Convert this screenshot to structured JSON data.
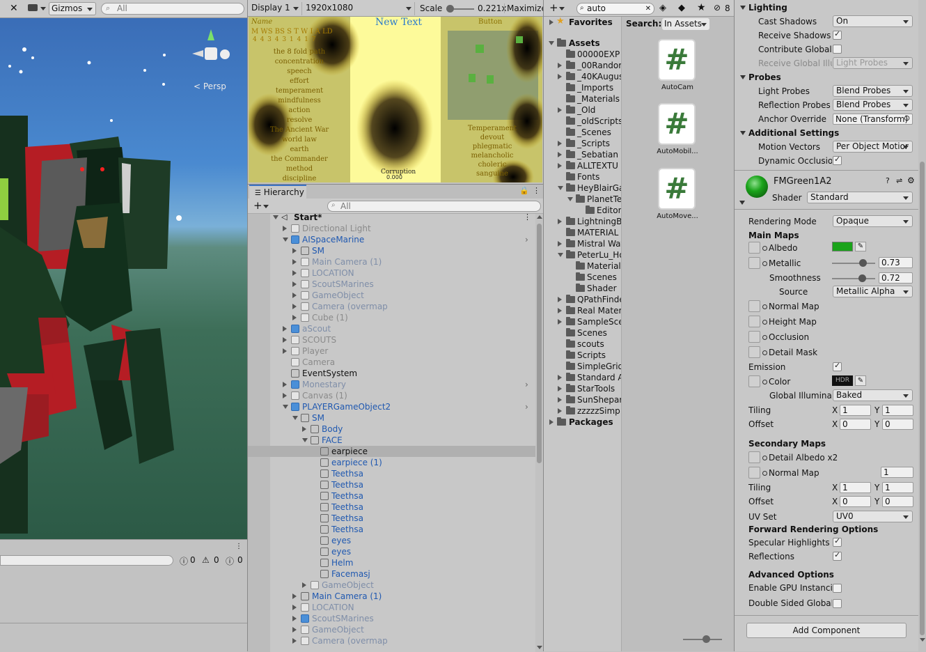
{
  "scene": {
    "toolbar": {
      "gizmos": "Gizmos",
      "search_placeholder": "All",
      "persp": "Persp"
    },
    "console": {
      "errors": "0",
      "warnings": "0",
      "messages": "0"
    }
  },
  "game": {
    "display": "Display 1",
    "resolution": "1920x1080",
    "scale_label": "Scale",
    "scale_value": "0.221x",
    "maximize": "Maximize",
    "overlay": {
      "name_header": "Name",
      "new_text": "New Text",
      "button_text": "Button",
      "stats_header": "M WS BS S T W I A LD",
      "stats_values": "4 4 3 4 3 1 4 1 7",
      "paths": [
        "the 8 fold path",
        "concentration",
        "speech",
        "effort",
        "temperament",
        "mindfulness",
        "action",
        "resolve",
        "The Ancient War",
        "world law",
        "earth",
        "the Commander",
        "method",
        "discipline"
      ],
      "right_list": [
        "Temperament",
        "devout",
        "phlegmatic",
        "melancholic",
        "choleric",
        "sanguine"
      ],
      "corruption": "Corruption",
      "corruption_value": "0.000"
    }
  },
  "hierarchy": {
    "title": "Hierarchy",
    "search_placeholder": "All",
    "scene_name": "Start*",
    "items": [
      {
        "label": "Directional Light",
        "indent": 1,
        "arrow": "r",
        "style": "dim",
        "icon": "gray"
      },
      {
        "label": "AISpaceMarine",
        "indent": 1,
        "arrow": "d",
        "style": "blue",
        "icon": "blue",
        "more": true
      },
      {
        "label": "SM",
        "indent": 2,
        "arrow": "r",
        "style": "blue",
        "icon": "plain"
      },
      {
        "label": "Main Camera (1)",
        "indent": 2,
        "arrow": "r",
        "style": "gray",
        "icon": "gray"
      },
      {
        "label": "LOCATION",
        "indent": 2,
        "arrow": "r",
        "style": "gray",
        "icon": "gray"
      },
      {
        "label": "ScoutSMarines",
        "indent": 2,
        "arrow": "r",
        "style": "gray",
        "icon": "gray"
      },
      {
        "label": "GameObject",
        "indent": 2,
        "arrow": "r",
        "style": "gray",
        "icon": "gray"
      },
      {
        "label": "Camera (overmap",
        "indent": 2,
        "arrow": "r",
        "style": "gray",
        "icon": "gray"
      },
      {
        "label": "Cube (1)",
        "indent": 2,
        "arrow": "r",
        "style": "dim",
        "icon": "gray"
      },
      {
        "label": "aScout",
        "indent": 1,
        "arrow": "r",
        "style": "gray",
        "icon": "blue"
      },
      {
        "label": "SCOUTS",
        "indent": 1,
        "arrow": "r",
        "style": "dim",
        "icon": "gray"
      },
      {
        "label": "Player",
        "indent": 1,
        "arrow": "r",
        "style": "dim",
        "icon": "gray"
      },
      {
        "label": "Camera",
        "indent": 1,
        "arrow": "",
        "style": "dim",
        "icon": "gray"
      },
      {
        "label": "EventSystem",
        "indent": 1,
        "arrow": "",
        "style": "normal",
        "icon": "plain"
      },
      {
        "label": "Monestary",
        "indent": 1,
        "arrow": "r",
        "style": "gray",
        "icon": "blue",
        "more": true
      },
      {
        "label": "Canvas (1)",
        "indent": 1,
        "arrow": "r",
        "style": "dim",
        "icon": "gray"
      },
      {
        "label": "PLAYERGameObject2",
        "indent": 1,
        "arrow": "d",
        "style": "blue",
        "icon": "blue",
        "more": true
      },
      {
        "label": "SM",
        "indent": 2,
        "arrow": "d",
        "style": "blue",
        "icon": "plain"
      },
      {
        "label": "Body",
        "indent": 3,
        "arrow": "r",
        "style": "blue",
        "icon": "plain"
      },
      {
        "label": "FACE",
        "indent": 3,
        "arrow": "d",
        "style": "blue",
        "icon": "plain"
      },
      {
        "label": "earpiece",
        "indent": 4,
        "arrow": "",
        "style": "normal",
        "icon": "plain",
        "selected": true
      },
      {
        "label": "earpiece (1)",
        "indent": 4,
        "arrow": "",
        "style": "blue",
        "icon": "plain"
      },
      {
        "label": "Teethsa",
        "indent": 4,
        "arrow": "",
        "style": "blue",
        "icon": "plain"
      },
      {
        "label": "Teethsa",
        "indent": 4,
        "arrow": "",
        "style": "blue",
        "icon": "plain"
      },
      {
        "label": "Teethsa",
        "indent": 4,
        "arrow": "",
        "style": "blue",
        "icon": "plain"
      },
      {
        "label": "Teethsa",
        "indent": 4,
        "arrow": "",
        "style": "blue",
        "icon": "plain"
      },
      {
        "label": "Teethsa",
        "indent": 4,
        "arrow": "",
        "style": "blue",
        "icon": "plain"
      },
      {
        "label": "Teethsa",
        "indent": 4,
        "arrow": "",
        "style": "blue",
        "icon": "plain"
      },
      {
        "label": "eyes",
        "indent": 4,
        "arrow": "",
        "style": "blue",
        "icon": "plain"
      },
      {
        "label": "eyes",
        "indent": 4,
        "arrow": "",
        "style": "blue",
        "icon": "plain"
      },
      {
        "label": "Helm",
        "indent": 4,
        "arrow": "",
        "style": "blue",
        "icon": "plain"
      },
      {
        "label": "Facemasj",
        "indent": 4,
        "arrow": "",
        "style": "blue",
        "icon": "plain"
      },
      {
        "label": "GameObject",
        "indent": 3,
        "arrow": "r",
        "style": "gray",
        "icon": "gray"
      },
      {
        "label": "Main Camera (1)",
        "indent": 2,
        "arrow": "r",
        "style": "blue",
        "icon": "plain"
      },
      {
        "label": "LOCATION",
        "indent": 2,
        "arrow": "r",
        "style": "gray",
        "icon": "gray"
      },
      {
        "label": "ScoutSMarines",
        "indent": 2,
        "arrow": "r",
        "style": "gray",
        "icon": "blue"
      },
      {
        "label": "GameObject",
        "indent": 2,
        "arrow": "r",
        "style": "gray",
        "icon": "gray"
      },
      {
        "label": "Camera (overmap",
        "indent": 2,
        "arrow": "r",
        "style": "gray",
        "icon": "gray"
      }
    ]
  },
  "project": {
    "search_value": "auto",
    "hidden_count": "8",
    "favorites": "Favorites",
    "assets": "Assets",
    "packages": "Packages",
    "search_label": "Search:",
    "search_scope": "In Assets",
    "tree": [
      {
        "label": "00000EXP",
        "indent": 1,
        "arrow": ""
      },
      {
        "label": "_00Randor",
        "indent": 1,
        "arrow": "r"
      },
      {
        "label": "_40KAugus",
        "indent": 1,
        "arrow": "r"
      },
      {
        "label": "_Imports",
        "indent": 1,
        "arrow": ""
      },
      {
        "label": "_Materials",
        "indent": 1,
        "arrow": ""
      },
      {
        "label": "_Old",
        "indent": 1,
        "arrow": "r"
      },
      {
        "label": "_oldScripts",
        "indent": 1,
        "arrow": ""
      },
      {
        "label": "_Scenes",
        "indent": 1,
        "arrow": ""
      },
      {
        "label": "_Scripts",
        "indent": 1,
        "arrow": "r"
      },
      {
        "label": "_Sebatian",
        "indent": 1,
        "arrow": "r"
      },
      {
        "label": "ALLTEXTU",
        "indent": 1,
        "arrow": "r"
      },
      {
        "label": "Fonts",
        "indent": 1,
        "arrow": ""
      },
      {
        "label": "HeyBlairGa",
        "indent": 1,
        "arrow": "d"
      },
      {
        "label": "PlanetTe",
        "indent": 2,
        "arrow": "d"
      },
      {
        "label": "Editor",
        "indent": 3,
        "arrow": ""
      },
      {
        "label": "LightningB",
        "indent": 1,
        "arrow": "r"
      },
      {
        "label": "MATERIAL",
        "indent": 1,
        "arrow": ""
      },
      {
        "label": "Mistral Wat",
        "indent": 1,
        "arrow": "r"
      },
      {
        "label": "PeterLu_Ho",
        "indent": 1,
        "arrow": "d"
      },
      {
        "label": "Material",
        "indent": 2,
        "arrow": ""
      },
      {
        "label": "Scenes",
        "indent": 2,
        "arrow": ""
      },
      {
        "label": "Shader",
        "indent": 2,
        "arrow": ""
      },
      {
        "label": "QPathFinde",
        "indent": 1,
        "arrow": "r"
      },
      {
        "label": "Real Mater",
        "indent": 1,
        "arrow": "r"
      },
      {
        "label": "SampleSce",
        "indent": 1,
        "arrow": "r"
      },
      {
        "label": "Scenes",
        "indent": 1,
        "arrow": ""
      },
      {
        "label": "scouts",
        "indent": 1,
        "arrow": ""
      },
      {
        "label": "Scripts",
        "indent": 1,
        "arrow": ""
      },
      {
        "label": "SimpleGrid",
        "indent": 1,
        "arrow": ""
      },
      {
        "label": "Standard A",
        "indent": 1,
        "arrow": "r"
      },
      {
        "label": "StarTools",
        "indent": 1,
        "arrow": "r"
      },
      {
        "label": "SunShepar",
        "indent": 1,
        "arrow": "r"
      },
      {
        "label": "zzzzzSimp",
        "indent": 1,
        "arrow": "r"
      }
    ],
    "results": [
      "AutoCam",
      "AutoMobil...",
      "AutoMove..."
    ]
  },
  "inspector": {
    "lighting": "Lighting",
    "cast_shadows": "Cast Shadows",
    "cast_shadows_value": "On",
    "receive_shadows": "Receive Shadows",
    "contribute_gi": "Contribute Global I",
    "receive_gi": "Receive Global Illu",
    "receive_gi_value": "Light Probes",
    "probes": "Probes",
    "light_probes": "Light Probes",
    "light_probes_value": "Blend Probes",
    "reflection_probes": "Reflection Probes",
    "reflection_probes_value": "Blend Probes",
    "anchor_override": "Anchor Override",
    "anchor_override_value": "None (Transform)",
    "additional": "Additional Settings",
    "motion_vectors": "Motion Vectors",
    "motion_vectors_value": "Per Object Motior",
    "dynamic_occlusion": "Dynamic Occlusion",
    "material_name": "FMGreen1A2",
    "shader_label": "Shader",
    "shader_value": "Standard",
    "rendering_mode": "Rendering Mode",
    "rendering_mode_value": "Opaque",
    "main_maps": "Main Maps",
    "albedo": "Albedo",
    "albedo_color": "#1aa31a",
    "metallic": "Metallic",
    "metallic_value": "0.73",
    "smoothness": "Smoothness",
    "smoothness_value": "0.72",
    "source": "Source",
    "source_value": "Metallic Alpha",
    "normal_map": "Normal Map",
    "height_map": "Height Map",
    "occlusion": "Occlusion",
    "detail_mask": "Detail Mask",
    "emission": "Emission",
    "color": "Color",
    "hdr": "HDR",
    "global_illum": "Global Illuminati",
    "global_illum_value": "Baked",
    "tiling": "Tiling",
    "offset": "Offset",
    "x": "X",
    "y": "Y",
    "tiling_x": "1",
    "tiling_y": "1",
    "offset_x": "0",
    "offset_y": "0",
    "secondary_maps": "Secondary Maps",
    "detail_albedo": "Detail Albedo x2",
    "normal_map2": "Normal Map",
    "normal_map2_value": "1",
    "tiling2_x": "1",
    "tiling2_y": "1",
    "offset2_x": "0",
    "offset2_y": "0",
    "uv_set": "UV Set",
    "uv_set_value": "UV0",
    "forward_opts": "Forward Rendering Options",
    "specular": "Specular Highlights",
    "reflections": "Reflections",
    "advanced": "Advanced Options",
    "gpu_instancing": "Enable GPU Instancir",
    "double_sided": "Double Sided Global I",
    "add_component": "Add Component"
  }
}
